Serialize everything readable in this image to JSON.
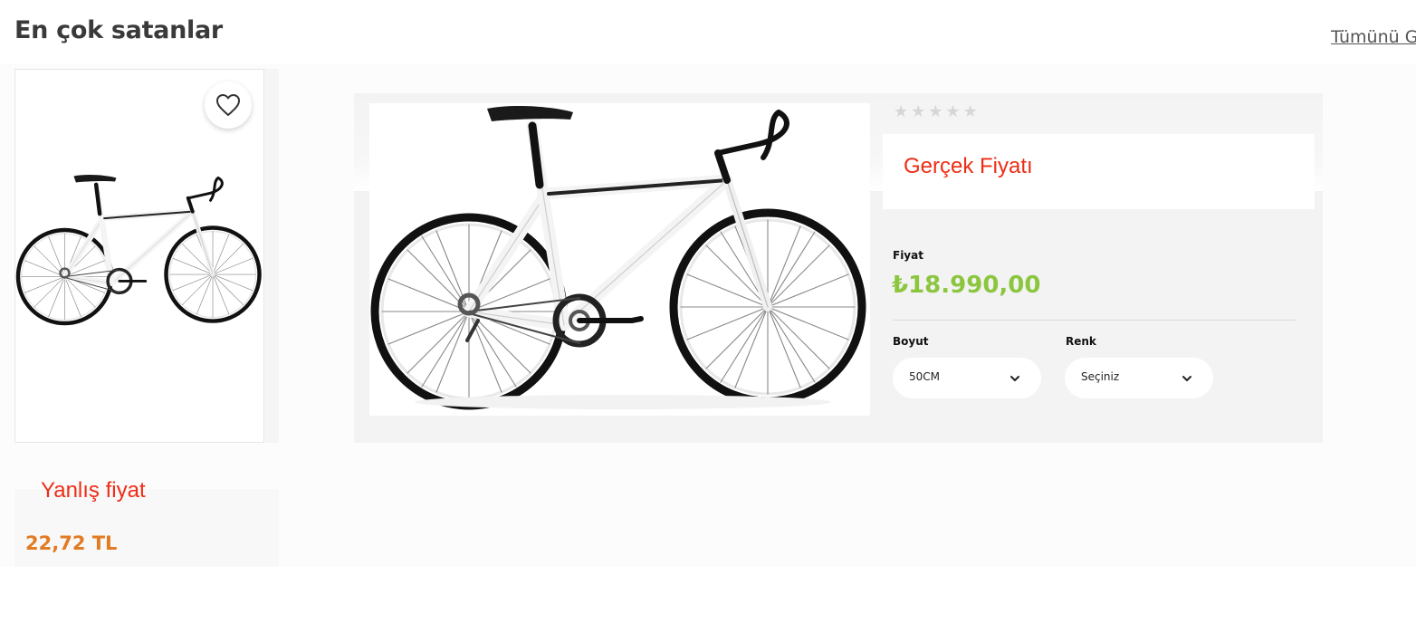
{
  "section": {
    "title": "En çok satanlar",
    "see_all": "Tümünü Gör"
  },
  "product_card": {
    "wrong_price_note": "Yanlış fiyat",
    "price": "22,72 TL",
    "image": "road-bike-white"
  },
  "quick_view": {
    "rating_stars": 5,
    "rating_value": 0,
    "real_price_note": "Gerçek Fiyatı",
    "price_label": "Fiyat",
    "price": "₺18.990,00",
    "size_label": "Boyut",
    "size_value": "50CM",
    "color_label": "Renk",
    "color_value": "Seçiniz",
    "image": "road-bike-white"
  },
  "colors": {
    "annotation_red": "#ee2d14",
    "price_green": "#8cc63f",
    "card_price_orange": "#e27b22"
  }
}
